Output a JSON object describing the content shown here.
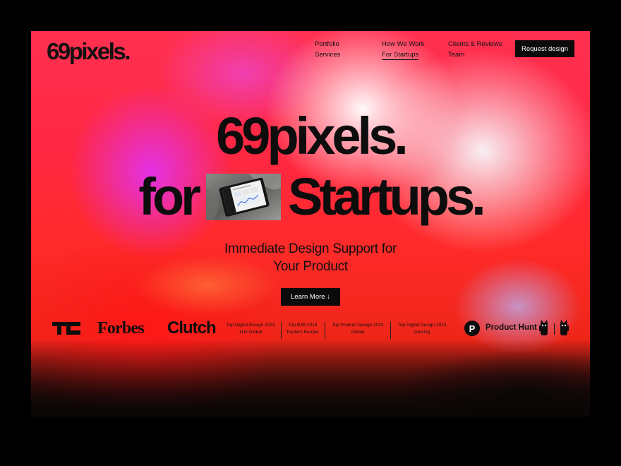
{
  "brand": {
    "logo": "69pixels."
  },
  "nav": {
    "items": [
      {
        "label": "Portfolio"
      },
      {
        "label": "Services"
      },
      {
        "label": "How We Work"
      },
      {
        "label": "For Startups"
      },
      {
        "label": "Clients & Reviews"
      },
      {
        "label": "Team"
      }
    ],
    "cta_label": "Request design"
  },
  "hero": {
    "line1": "69pixels.",
    "line2_prefix": "for",
    "line2_suffix": "Startups.",
    "subhead_line1": "Immediate Design Support for",
    "subhead_line2": "Your Product",
    "button_label": "Learn More ↓"
  },
  "press": {
    "forbes": "Forbes",
    "clutch": "Clutch"
  },
  "awards": [
    {
      "line1": "Top Digital Design 2023",
      "line2": "11th Global"
    },
    {
      "line1": "Top B2B 2019",
      "line2": "Eastern Europe"
    },
    {
      "line1": "Top Product Design 2023",
      "line2": "Global"
    },
    {
      "line1": "Top Digital Design 2023",
      "line2": "Gaming"
    }
  ],
  "product_hunt": {
    "badge_letter": "P",
    "label": "Product Hunt"
  },
  "colors": {
    "accent_dark": "#0b0b0b",
    "gradient_red": "#ff2a2a",
    "gradient_magenta": "#e132f0"
  },
  "icons": [
    "techcrunch-logo-icon",
    "product-hunt-icon",
    "kitty-badge-icon"
  ]
}
